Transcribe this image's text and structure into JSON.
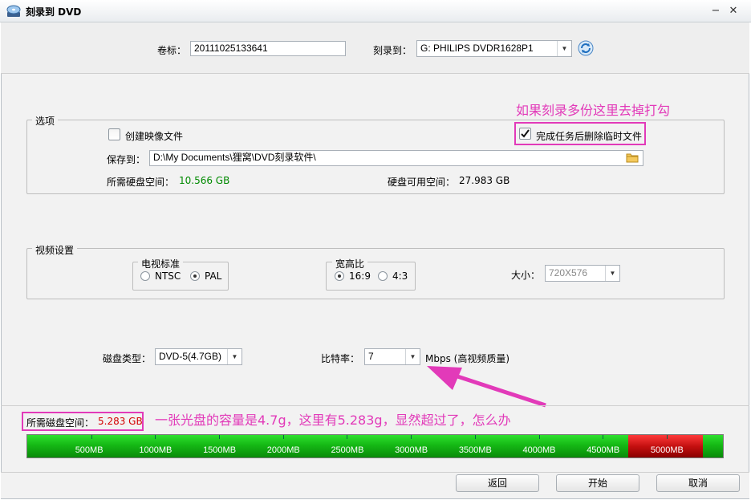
{
  "window": {
    "title": "刻录到 DVD",
    "minimize": "−",
    "close": "✕"
  },
  "volume": {
    "label": "卷标：",
    "value": "20111025133641"
  },
  "burn_to": {
    "label": "刻录到：",
    "value": "G: PHILIPS  DVDR1628P1"
  },
  "options": {
    "title": "选项",
    "create_image": "创建映像文件",
    "delete_temp": "完成任务后删除临时文件",
    "save_to_label": "保存到：",
    "save_to_value": "D:\\My Documents\\狸窝\\DVD刻录软件\\",
    "needed_label": "所需硬盘空间：",
    "needed_value": "10.566 GB",
    "available_label": "硬盘可用空间：",
    "available_value": "27.983 GB"
  },
  "annotation_top": "如果刻录多份这里去掉打勾",
  "video": {
    "title": "视频设置",
    "tv_standard_title": "电视标准",
    "ntsc": "NTSC",
    "pal": "PAL",
    "aspect_title": "宽高比",
    "ratio_169": "16:9",
    "ratio_43": "4:3",
    "size_label": "大小：",
    "size_value": "720X576"
  },
  "disc": {
    "type_label": "磁盘类型：",
    "type_value": "DVD-5(4.7GB)"
  },
  "bitrate": {
    "label": "比特率：",
    "value": "7",
    "unit": "Mbps (高视频质量)"
  },
  "space": {
    "label": "所需磁盘空间：",
    "value": "5.283 GB"
  },
  "annotation_bottom": "一张光盘的容量是4.7g，这里有5.283g，显然超过了，怎么办",
  "capacity_bar": {
    "ticks": [
      "500MB",
      "1000MB",
      "1500MB",
      "2000MB",
      "2500MB",
      "3000MB",
      "3500MB",
      "4000MB",
      "4500MB",
      "5000MB"
    ],
    "capacity_mb": 4700,
    "required_mb": 5283
  },
  "buttons": {
    "back": "返回",
    "start": "开始",
    "cancel": "取消"
  },
  "colors": {
    "annotation": "#e23ab9",
    "required_space": "#d40000",
    "needed_disk": "#008a00",
    "bar_fill": "#15b815",
    "bar_over": "#c41010"
  },
  "icons": {
    "app": "dvd-burn-icon",
    "refresh": "refresh-icon",
    "folder": "folder-icon",
    "check": "check-icon"
  }
}
